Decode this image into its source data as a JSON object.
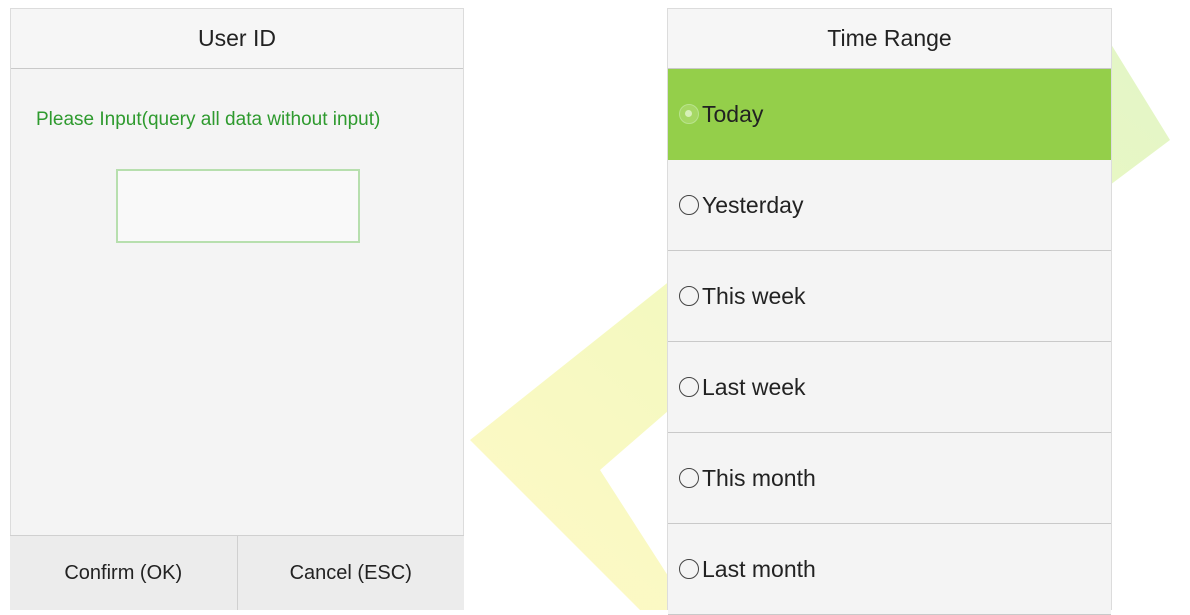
{
  "user_id_dialog": {
    "title": "User ID",
    "prompt": "Please Input(query all data without input)",
    "input_value": "",
    "confirm_label": "Confirm (OK)",
    "cancel_label": "Cancel (ESC)"
  },
  "time_range_dialog": {
    "title": "Time Range",
    "options": [
      {
        "label": "Today",
        "selected": true
      },
      {
        "label": "Yesterday",
        "selected": false
      },
      {
        "label": "This week",
        "selected": false
      },
      {
        "label": "Last week",
        "selected": false
      },
      {
        "label": "This month",
        "selected": false
      },
      {
        "label": "Last month",
        "selected": false
      }
    ]
  },
  "colors": {
    "accent_green": "#94cf4a",
    "prompt_green": "#2e9a2e",
    "watermark_yellow": "#fff200",
    "watermark_green": "#9ad24a"
  }
}
